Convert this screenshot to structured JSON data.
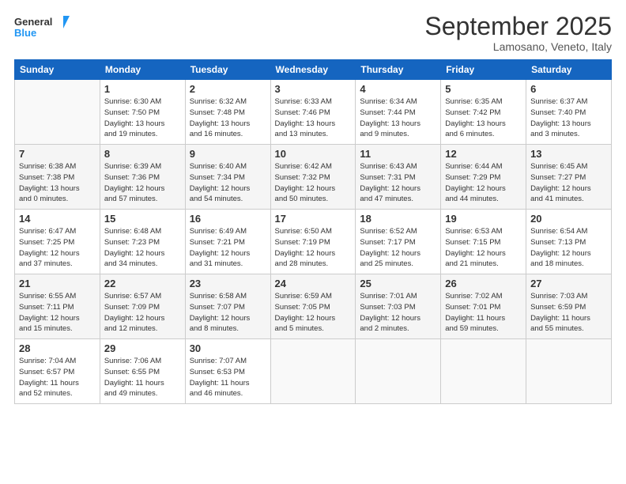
{
  "logo": {
    "line1": "General",
    "line2": "Blue"
  },
  "title": "September 2025",
  "location": "Lamosano, Veneto, Italy",
  "days_of_week": [
    "Sunday",
    "Monday",
    "Tuesday",
    "Wednesday",
    "Thursday",
    "Friday",
    "Saturday"
  ],
  "weeks": [
    [
      {
        "day": "",
        "info": ""
      },
      {
        "day": "1",
        "info": "Sunrise: 6:30 AM\nSunset: 7:50 PM\nDaylight: 13 hours\nand 19 minutes."
      },
      {
        "day": "2",
        "info": "Sunrise: 6:32 AM\nSunset: 7:48 PM\nDaylight: 13 hours\nand 16 minutes."
      },
      {
        "day": "3",
        "info": "Sunrise: 6:33 AM\nSunset: 7:46 PM\nDaylight: 13 hours\nand 13 minutes."
      },
      {
        "day": "4",
        "info": "Sunrise: 6:34 AM\nSunset: 7:44 PM\nDaylight: 13 hours\nand 9 minutes."
      },
      {
        "day": "5",
        "info": "Sunrise: 6:35 AM\nSunset: 7:42 PM\nDaylight: 13 hours\nand 6 minutes."
      },
      {
        "day": "6",
        "info": "Sunrise: 6:37 AM\nSunset: 7:40 PM\nDaylight: 13 hours\nand 3 minutes."
      }
    ],
    [
      {
        "day": "7",
        "info": "Sunrise: 6:38 AM\nSunset: 7:38 PM\nDaylight: 13 hours\nand 0 minutes."
      },
      {
        "day": "8",
        "info": "Sunrise: 6:39 AM\nSunset: 7:36 PM\nDaylight: 12 hours\nand 57 minutes."
      },
      {
        "day": "9",
        "info": "Sunrise: 6:40 AM\nSunset: 7:34 PM\nDaylight: 12 hours\nand 54 minutes."
      },
      {
        "day": "10",
        "info": "Sunrise: 6:42 AM\nSunset: 7:32 PM\nDaylight: 12 hours\nand 50 minutes."
      },
      {
        "day": "11",
        "info": "Sunrise: 6:43 AM\nSunset: 7:31 PM\nDaylight: 12 hours\nand 47 minutes."
      },
      {
        "day": "12",
        "info": "Sunrise: 6:44 AM\nSunset: 7:29 PM\nDaylight: 12 hours\nand 44 minutes."
      },
      {
        "day": "13",
        "info": "Sunrise: 6:45 AM\nSunset: 7:27 PM\nDaylight: 12 hours\nand 41 minutes."
      }
    ],
    [
      {
        "day": "14",
        "info": "Sunrise: 6:47 AM\nSunset: 7:25 PM\nDaylight: 12 hours\nand 37 minutes."
      },
      {
        "day": "15",
        "info": "Sunrise: 6:48 AM\nSunset: 7:23 PM\nDaylight: 12 hours\nand 34 minutes."
      },
      {
        "day": "16",
        "info": "Sunrise: 6:49 AM\nSunset: 7:21 PM\nDaylight: 12 hours\nand 31 minutes."
      },
      {
        "day": "17",
        "info": "Sunrise: 6:50 AM\nSunset: 7:19 PM\nDaylight: 12 hours\nand 28 minutes."
      },
      {
        "day": "18",
        "info": "Sunrise: 6:52 AM\nSunset: 7:17 PM\nDaylight: 12 hours\nand 25 minutes."
      },
      {
        "day": "19",
        "info": "Sunrise: 6:53 AM\nSunset: 7:15 PM\nDaylight: 12 hours\nand 21 minutes."
      },
      {
        "day": "20",
        "info": "Sunrise: 6:54 AM\nSunset: 7:13 PM\nDaylight: 12 hours\nand 18 minutes."
      }
    ],
    [
      {
        "day": "21",
        "info": "Sunrise: 6:55 AM\nSunset: 7:11 PM\nDaylight: 12 hours\nand 15 minutes."
      },
      {
        "day": "22",
        "info": "Sunrise: 6:57 AM\nSunset: 7:09 PM\nDaylight: 12 hours\nand 12 minutes."
      },
      {
        "day": "23",
        "info": "Sunrise: 6:58 AM\nSunset: 7:07 PM\nDaylight: 12 hours\nand 8 minutes."
      },
      {
        "day": "24",
        "info": "Sunrise: 6:59 AM\nSunset: 7:05 PM\nDaylight: 12 hours\nand 5 minutes."
      },
      {
        "day": "25",
        "info": "Sunrise: 7:01 AM\nSunset: 7:03 PM\nDaylight: 12 hours\nand 2 minutes."
      },
      {
        "day": "26",
        "info": "Sunrise: 7:02 AM\nSunset: 7:01 PM\nDaylight: 11 hours\nand 59 minutes."
      },
      {
        "day": "27",
        "info": "Sunrise: 7:03 AM\nSunset: 6:59 PM\nDaylight: 11 hours\nand 55 minutes."
      }
    ],
    [
      {
        "day": "28",
        "info": "Sunrise: 7:04 AM\nSunset: 6:57 PM\nDaylight: 11 hours\nand 52 minutes."
      },
      {
        "day": "29",
        "info": "Sunrise: 7:06 AM\nSunset: 6:55 PM\nDaylight: 11 hours\nand 49 minutes."
      },
      {
        "day": "30",
        "info": "Sunrise: 7:07 AM\nSunset: 6:53 PM\nDaylight: 11 hours\nand 46 minutes."
      },
      {
        "day": "",
        "info": ""
      },
      {
        "day": "",
        "info": ""
      },
      {
        "day": "",
        "info": ""
      },
      {
        "day": "",
        "info": ""
      }
    ]
  ]
}
